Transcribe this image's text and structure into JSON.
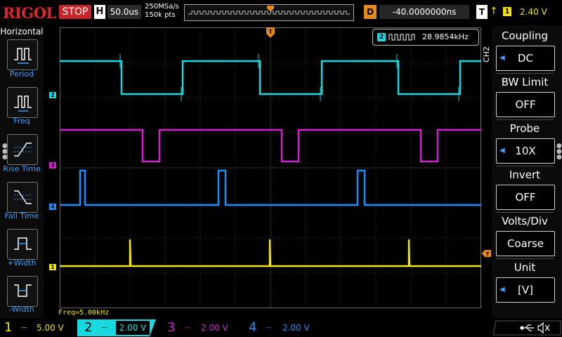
{
  "brand": {
    "name_red": "RIGOL"
  },
  "status": {
    "run_state": "STOP"
  },
  "horizontal": {
    "label": "H",
    "timebase": "50.0us",
    "sample_rate": "250MSa/s",
    "points": "150k pts"
  },
  "delay": {
    "label": "D",
    "value": "-40.0000000ns"
  },
  "trigger": {
    "label": "T",
    "source": "1",
    "level": "2.40 V",
    "edge_icon": "rising-edge-icon"
  },
  "left_menu": {
    "title": "Horizontal",
    "items": [
      {
        "label": "Period",
        "icon": "period-icon"
      },
      {
        "label": "Freq",
        "icon": "freq-icon"
      },
      {
        "label": "Rise Time",
        "icon": "rise-time-icon"
      },
      {
        "label": "Fall Time",
        "icon": "fall-time-icon"
      },
      {
        "label": "+Width",
        "icon": "pos-width-icon"
      },
      {
        "label": "-Width",
        "icon": "neg-width-icon"
      }
    ]
  },
  "measurement": {
    "channel": "2",
    "value": "28.9854kHz"
  },
  "counter": {
    "text": "Freq=5.00kHz"
  },
  "right_menu": {
    "channel_tag": "CH2",
    "items": [
      {
        "title": "Coupling",
        "value": "DC",
        "has_arrow": true
      },
      {
        "title": "BW Limit",
        "value": "OFF",
        "has_arrow": false
      },
      {
        "title": "Probe",
        "value": "10X",
        "has_arrow": true
      },
      {
        "title": "Invert",
        "value": "OFF",
        "has_arrow": false
      },
      {
        "title": "Volts/Div",
        "value": "Coarse",
        "has_arrow": false
      },
      {
        "title": "Unit",
        "value": "[V]",
        "has_arrow": true
      }
    ]
  },
  "channels": [
    {
      "num": "1",
      "scale": "5.00 V",
      "color": "#f3e600"
    },
    {
      "num": "2",
      "scale": "2.00 V",
      "color": "#19d9e0"
    },
    {
      "num": "3",
      "scale": "2.00 V",
      "color": "#d61fd6"
    },
    {
      "num": "4",
      "scale": "2.00 V",
      "color": "#1e8fff"
    }
  ],
  "colors": {
    "stop_red": "#c8252b",
    "delay_orange": "#e58a1f",
    "menu_blue": "#3ea0ff"
  }
}
